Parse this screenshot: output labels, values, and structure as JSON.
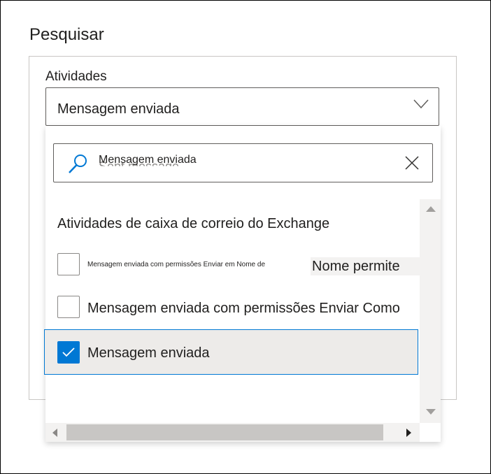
{
  "page": {
    "title": "Pesquisar"
  },
  "activities": {
    "label": "Atividades",
    "selected_value": "Mensagem enviada"
  },
  "dropdown": {
    "search": {
      "value": "Mensagem enviada",
      "ghost_text": "Sent message"
    },
    "section_title": "Atividades de caixa de correio do Exchange",
    "options": [
      {
        "label": "Mensagem enviada com permissões Enviar em Nome de",
        "overlay_label": "Nome permite",
        "checked": false
      },
      {
        "label": "Mensagem enviada com permissões Enviar Como",
        "checked": false
      },
      {
        "label": "Mensagem enviada",
        "checked": true
      }
    ]
  },
  "colors": {
    "accent": "#0078d4",
    "selected_row_bg": "#edebe9",
    "border": "#605e5c",
    "scrollbar_bg": "#f3f2f1"
  },
  "icons": {
    "select": "chevron-down-icon",
    "search": "search-icon",
    "clear": "close-icon",
    "checkmark": "checkmark-icon"
  }
}
